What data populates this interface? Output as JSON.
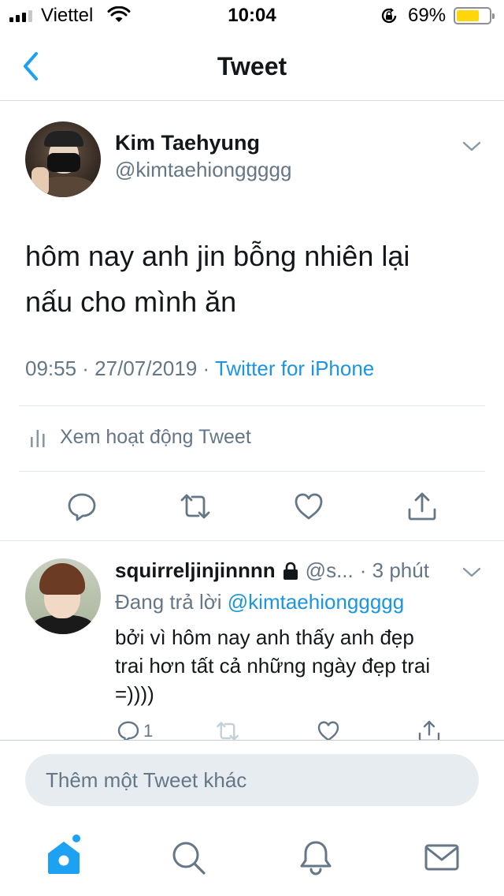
{
  "status_bar": {
    "carrier": "Viettel",
    "time": "10:04",
    "battery_percent": "69%",
    "battery_level": 0.69,
    "icons": [
      "signal-bars-icon",
      "wifi-icon",
      "rotation-lock-icon",
      "battery-icon"
    ]
  },
  "nav": {
    "title": "Tweet",
    "back_icon": "chevron-left-icon"
  },
  "tweet": {
    "author_name": "Kim Taehyung",
    "author_handle": "@kimtaehionggggg",
    "text_line1": "hôm nay anh jin bỗng nhiên lại",
    "text_line2": "nấu cho mình ăn",
    "timestamp": "09:55 · 27/07/2019 · ",
    "source": "Twitter for iPhone",
    "activity_label": "Xem hoạt động Tweet",
    "actions": [
      "reply-icon",
      "retweet-icon",
      "like-icon",
      "share-icon"
    ]
  },
  "reply": {
    "author_name": "squirreljinjinnnn",
    "author_handle": "@s...",
    "time": "· 3 phút",
    "replying_prefix": "Đang trả lời ",
    "replying_mention": "@kimtaehionggggg",
    "text_line1": "bởi vì hôm nay anh thấy anh đẹp",
    "text_line2": "trai hơn tất cả những ngày đẹp trai",
    "text_line3": "=))))",
    "reply_count": "1"
  },
  "composer": {
    "placeholder": "Thêm một Tweet khác"
  },
  "tabbar": {
    "items": [
      "home-icon",
      "search-icon",
      "notifications-icon",
      "messages-icon"
    ]
  },
  "colors": {
    "accent": "#1da1f2",
    "link": "#1b95e0",
    "secondary_text": "#657786",
    "icon_gray": "#657786",
    "battery": "#ffd60a"
  }
}
